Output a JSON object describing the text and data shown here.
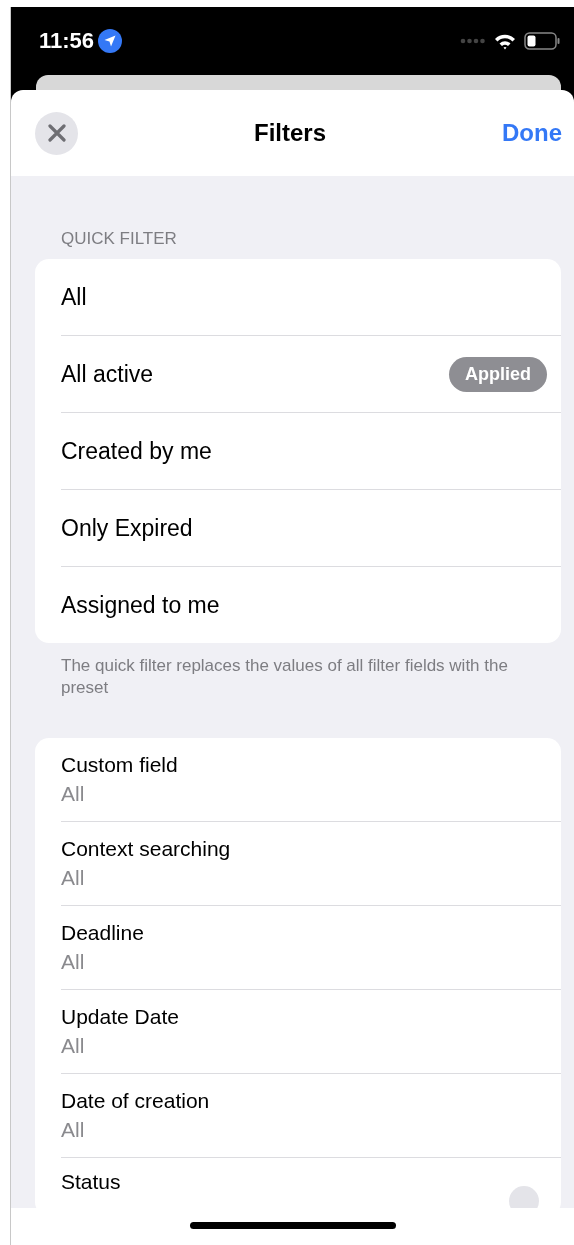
{
  "status_bar": {
    "time": "11:56"
  },
  "header": {
    "title": "Filters",
    "done": "Done"
  },
  "quick_filter": {
    "heading": "QUICK FILTER",
    "items": [
      {
        "label": "All",
        "applied": false
      },
      {
        "label": "All active",
        "applied": true,
        "badge": "Applied"
      },
      {
        "label": "Created by me",
        "applied": false
      },
      {
        "label": "Only Expired",
        "applied": false
      },
      {
        "label": "Assigned to me",
        "applied": false
      }
    ],
    "footer": "The quick filter replaces the values of all filter fields with the preset"
  },
  "fields": [
    {
      "label": "Custom field",
      "value": "All"
    },
    {
      "label": "Context searching",
      "value": "All"
    },
    {
      "label": "Deadline",
      "value": "All"
    },
    {
      "label": "Update Date",
      "value": "All"
    },
    {
      "label": "Date of creation",
      "value": "All"
    },
    {
      "label": "Status",
      "clearable": true
    }
  ]
}
